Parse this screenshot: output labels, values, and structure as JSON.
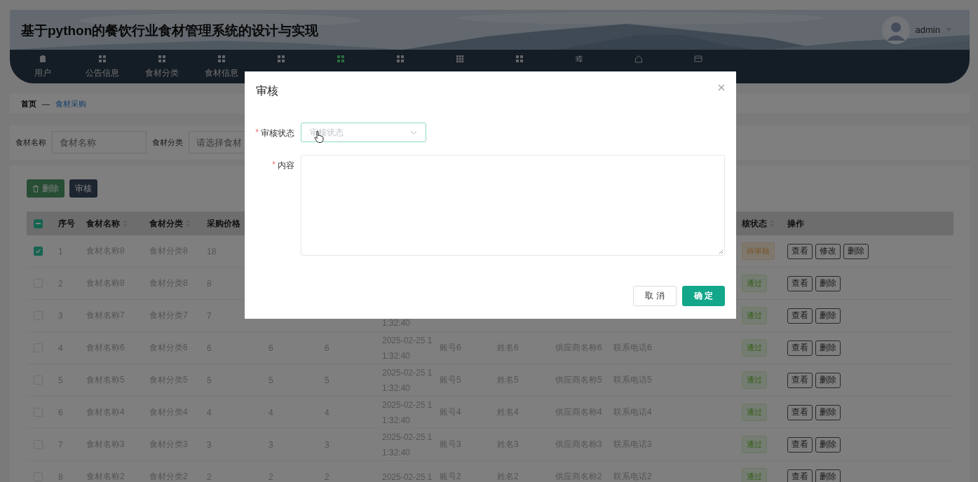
{
  "header": {
    "title": "基于python的餐饮行业食材管理系统的设计与实现",
    "user": "admin"
  },
  "nav": [
    {
      "label": "用户",
      "kind": "clipboard",
      "selected": false
    },
    {
      "label": "公告信息",
      "kind": "grid",
      "selected": false
    },
    {
      "label": "食材分类",
      "kind": "grid",
      "selected": false
    },
    {
      "label": "食材信息",
      "kind": "grid",
      "selected": false
    },
    {
      "kind": "grid",
      "selected": false
    },
    {
      "kind": "grid",
      "selected": true
    },
    {
      "kind": "grid",
      "selected": false
    },
    {
      "kind": "grid9",
      "selected": false
    },
    {
      "kind": "grid",
      "selected": false
    },
    {
      "kind": "sliders",
      "selected": false
    },
    {
      "kind": "home",
      "selected": false
    },
    {
      "kind": "card",
      "selected": false
    }
  ],
  "breadcrumb": {
    "home": "首页",
    "separator": "—",
    "current": "食材采购"
  },
  "search": [
    {
      "label": "食材名称",
      "placeholder": "食材名称"
    },
    {
      "label": "食材分类",
      "placeholder": "请选择食材"
    }
  ],
  "toolbar": [
    {
      "label": "删除",
      "kind": "danger"
    },
    {
      "label": "审核",
      "kind": "dark"
    }
  ],
  "table": {
    "header_checkbox": {
      "indeterminate": true
    },
    "columns": [
      {
        "label": "序号",
        "sortable": false
      },
      {
        "label": "食材名称",
        "sortable": true
      },
      {
        "label": "食材分类",
        "sortable": true
      },
      {
        "label": "采购价格",
        "sortable": false
      },
      {
        "label": "核状态",
        "sortable": true
      },
      {
        "label": "操作",
        "sortable": false
      }
    ],
    "rows": [
      {
        "checked": true,
        "cells": [
          "1",
          "食材名称8",
          "食材分类8",
          "18"
        ],
        "status": {
          "label": "待审核",
          "kind": "pending"
        },
        "actions": [
          "查看",
          "修改",
          "删除"
        ]
      },
      {
        "checked": false,
        "cells": [
          "2",
          "食材名称8",
          "食材分类8",
          "8"
        ],
        "status": {
          "label": "通过",
          "kind": "pass"
        },
        "actions": [
          "查看",
          "删除"
        ]
      },
      {
        "checked": false,
        "cells": [
          "3",
          "食材名称7",
          "食材分类7",
          "7",
          null,
          null,
          "1:32:40"
        ],
        "status": {
          "label": "通过",
          "kind": "pass"
        },
        "actions": [
          "查看",
          "删除"
        ]
      },
      {
        "checked": false,
        "cells": [
          "4",
          "食材名称6",
          "食材分类6",
          "6",
          "6",
          "6",
          "2025-02-25 11:32:40",
          "账号6",
          "姓名6",
          "供应商名称6",
          "联系电话6"
        ],
        "status": {
          "label": "通过",
          "kind": "pass"
        },
        "actions": [
          "查看",
          "删除"
        ]
      },
      {
        "checked": false,
        "cells": [
          "5",
          "食材名称5",
          "食材分类5",
          "5",
          "5",
          "5",
          "2025-02-25 11:32:40",
          "账号5",
          "姓名5",
          "供应商名称5",
          "联系电话5"
        ],
        "status": {
          "label": "通过",
          "kind": "pass"
        },
        "actions": [
          "查看",
          "删除"
        ]
      },
      {
        "checked": false,
        "cells": [
          "6",
          "食材名称4",
          "食材分类4",
          "4",
          "4",
          "4",
          "2025-02-25 11:32:40",
          "账号4",
          "姓名4",
          "供应商名称4",
          "联系电话4"
        ],
        "status": {
          "label": "通过",
          "kind": "pass"
        },
        "actions": [
          "查看",
          "删除"
        ]
      },
      {
        "checked": false,
        "cells": [
          "7",
          "食材名称3",
          "食材分类3",
          "3",
          "3",
          "3",
          "2025-02-25 11:32:40",
          "账号3",
          "姓名3",
          "供应商名称3",
          "联系电话3"
        ],
        "status": {
          "label": "通过",
          "kind": "pass"
        },
        "actions": [
          "查看",
          "删除"
        ]
      },
      {
        "checked": false,
        "cells": [
          "8",
          "食材名称2",
          "食材分类2",
          "2",
          "2",
          "2",
          "2025-02-25 1",
          "账号2",
          "姓名2",
          "供应商名称2",
          "联系电话2"
        ],
        "status": {
          "label": "通过",
          "kind": "pass"
        },
        "actions": [
          "查看",
          "删除"
        ]
      }
    ]
  },
  "dialog": {
    "title": "审核",
    "fields": [
      {
        "label": "审核状态",
        "marker": "*",
        "kind": "select",
        "placeholder": "审核状态"
      },
      {
        "label": "内容",
        "marker": "*",
        "kind": "textarea"
      }
    ],
    "buttons": [
      {
        "label": "取 消",
        "kind": "default"
      },
      {
        "label": "确 定",
        "kind": "primary"
      }
    ]
  }
}
